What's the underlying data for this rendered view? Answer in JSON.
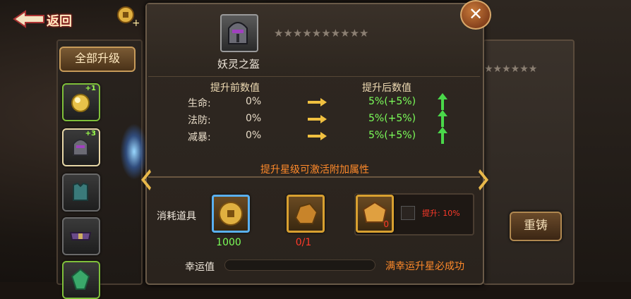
{
  "nav": {
    "back_label": "返回"
  },
  "left": {
    "all_upgrade_label": "全部升级",
    "slots": [
      {
        "level": "+1"
      },
      {
        "level": "+3"
      },
      {
        "level": ""
      },
      {
        "level": ""
      },
      {
        "level": ""
      }
    ]
  },
  "item": {
    "name": "妖灵之盔",
    "stars": "★★★★★★★★★★"
  },
  "stats": {
    "before_header": "提升前数值",
    "after_header": "提升后数值",
    "rows": [
      {
        "label": "生命:",
        "before": "0%",
        "after": "5%(+5%)"
      },
      {
        "label": "法防:",
        "before": "0%",
        "after": "5%(+5%)"
      },
      {
        "label": "减暴:",
        "before": "0%",
        "after": "5%(+5%)"
      }
    ]
  },
  "hint": "提升星级可激活附加属性",
  "consume": {
    "label": "消耗道具",
    "items": [
      {
        "name": "coin",
        "qty": "1000",
        "qty_color": "#7cff5a"
      },
      {
        "name": "ore",
        "qty": "0/1",
        "qty_color": "#ff3a2a"
      },
      {
        "name": "protect-stone",
        "qty": "0",
        "qty_color": "#ff3a2a"
      }
    ],
    "protect_text": "提升: 10%"
  },
  "luck": {
    "label": "幸运值",
    "hint": "满幸运升星必成功",
    "progress": 0
  },
  "right": {
    "recast_label": "重铸",
    "stars": "★★★★★★"
  },
  "colors": {
    "accent_orange": "#ff8a2a",
    "gain_green": "#7cff5a",
    "warn_red": "#ff3a2a"
  }
}
